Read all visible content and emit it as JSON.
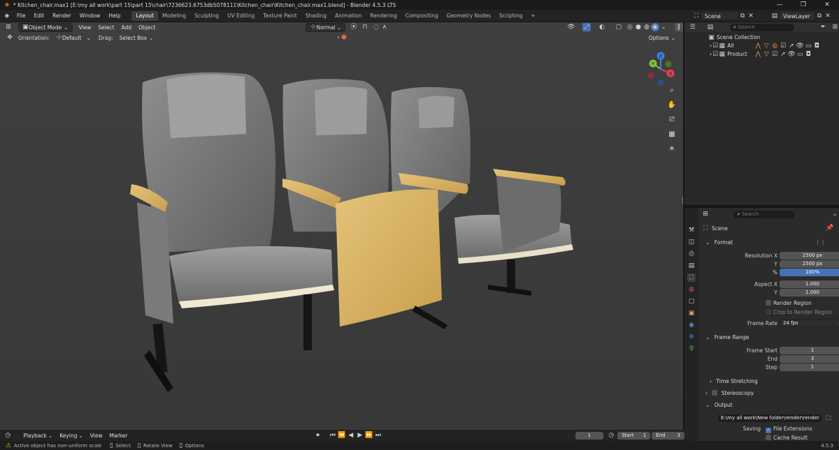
{
  "window": {
    "title": "* Kitchen_chair.max1 [E:\\my all work\\part 15\\part 15\\chair\\7236623.6753db5078111\\Kitchen_chair\\Kitchen_chair.max1.blend] - Blender 4.5.3 LTS"
  },
  "menu": [
    "File",
    "Edit",
    "Render",
    "Window",
    "Help"
  ],
  "workspaces": [
    "Layout",
    "Modeling",
    "Sculpting",
    "UV Editing",
    "Texture Paint",
    "Shading",
    "Animation",
    "Rendering",
    "Compositing",
    "Geometry Nodes",
    "Scripting"
  ],
  "active_workspace": "Layout",
  "scene_selector": "Scene",
  "viewlayer_selector": "ViewLayer",
  "viewport": {
    "mode": "Object Mode",
    "menus": [
      "View",
      "Select",
      "Add",
      "Object"
    ],
    "transform_orientation": "Normal",
    "orientation_label": "Orientation:",
    "orientation_value": "Default",
    "drag_label": "Drag:",
    "drag_value": "Select Box",
    "options_label": "Options",
    "gizmo_axes": [
      "X",
      "Y",
      "Z"
    ]
  },
  "outliner": {
    "search_placeholder": "Search",
    "root": "Scene Collection",
    "collections": [
      "All",
      "Product"
    ]
  },
  "properties": {
    "search_placeholder": "Search",
    "context": "Scene",
    "format": {
      "title": "Format",
      "resolution_x_label": "Resolution X",
      "resolution_x": "2500 px",
      "resolution_y_label": "Y",
      "resolution_y": "2500 px",
      "percent_label": "%",
      "percent": "100%",
      "aspect_x_label": "Aspect X",
      "aspect_x": "1.000",
      "aspect_y_label": "Y",
      "aspect_y": "1.000",
      "render_region": "Render Region",
      "crop_region": "Crop to Render Region",
      "frame_rate_label": "Frame Rate",
      "frame_rate": "24 fps"
    },
    "frame_range": {
      "title": "Frame Range",
      "start_label": "Frame Start",
      "start": "1",
      "end_label": "End",
      "end": "3",
      "step_label": "Step",
      "step": "1"
    },
    "time_stretching": "Time Stretching",
    "stereoscopy": "Stereoscopy",
    "output": {
      "title": "Output",
      "path": "E:\\my all work\\New folder\\render\\render",
      "saving_label": "Saving",
      "file_extensions": "File Extensions",
      "cache_result": "Cache Result"
    }
  },
  "timeline": {
    "menus": [
      "Playback",
      "Keying",
      "View",
      "Marker"
    ],
    "current_frame": "1",
    "start_label": "Start",
    "start": "1",
    "end_label": "End",
    "end": "3"
  },
  "status": {
    "message": "Active object has non-uniform scale",
    "select": "Select",
    "rotate": "Rotate View",
    "options": "Options",
    "version": "4.5.3"
  }
}
